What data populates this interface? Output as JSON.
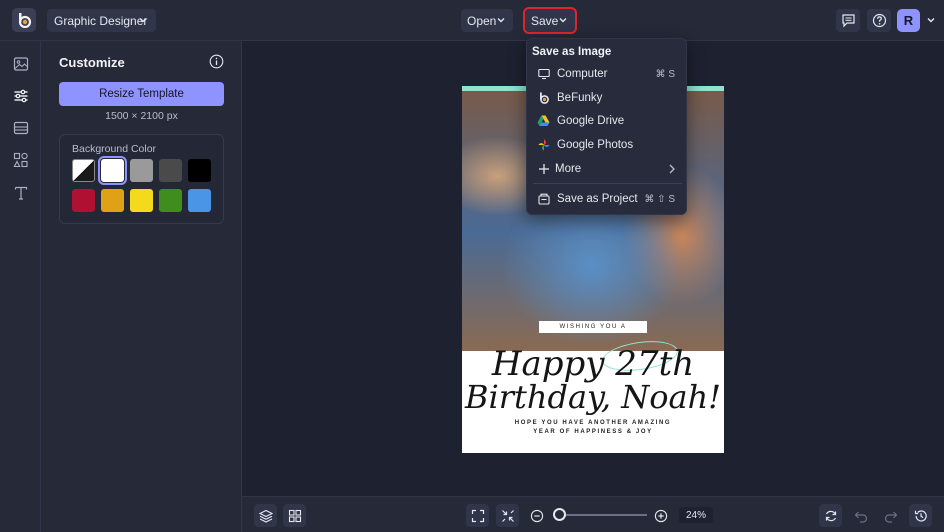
{
  "topbar": {
    "app_mode": "Graphic Designer",
    "open_label": "Open",
    "save_label": "Save",
    "avatar_initial": "R"
  },
  "rail": {
    "items": [
      "image-icon",
      "adjustments-icon",
      "layout-icon",
      "shapes-icon",
      "text-icon"
    ]
  },
  "panel": {
    "title": "Customize",
    "resize_label": "Resize Template",
    "dimensions": "1500 × 2100 px",
    "bg_label": "Background Color",
    "swatches": [
      "transparent",
      "#ffffff",
      "#9a9a9a",
      "#4a4a4a",
      "#000000",
      "#b01031",
      "#dfa115",
      "#f3da1c",
      "#3f8e1d",
      "#4a95e6"
    ],
    "selected_swatch": "#ffffff"
  },
  "design": {
    "wishing": "WISHING YOU A",
    "line1": "Happy 27th",
    "line2": "Birthday, Noah!",
    "sub1": "HOPE YOU HAVE ANOTHER AMAZING",
    "sub2": "YEAR OF HAPPINESS & JOY"
  },
  "menu": {
    "header": "Save as Image",
    "items": [
      {
        "label": "Computer",
        "shortcut": "⌘ S",
        "icon": "monitor-icon"
      },
      {
        "label": "BeFunky",
        "shortcut": "",
        "icon": "befunky-icon"
      },
      {
        "label": "Google Drive",
        "shortcut": "",
        "icon": "google-drive-icon"
      },
      {
        "label": "Google Photos",
        "shortcut": "",
        "icon": "google-photos-icon"
      },
      {
        "label": "More",
        "shortcut": "",
        "icon": "plus-icon"
      },
      {
        "label": "Save as Project",
        "shortcut": "⌘ ⇧ S",
        "icon": "project-icon"
      }
    ]
  },
  "bottombar": {
    "zoom": "24%"
  },
  "colors": {
    "accent": "#8f93ff",
    "highlight": "#e0252a",
    "teal": "#8ee3d2"
  }
}
